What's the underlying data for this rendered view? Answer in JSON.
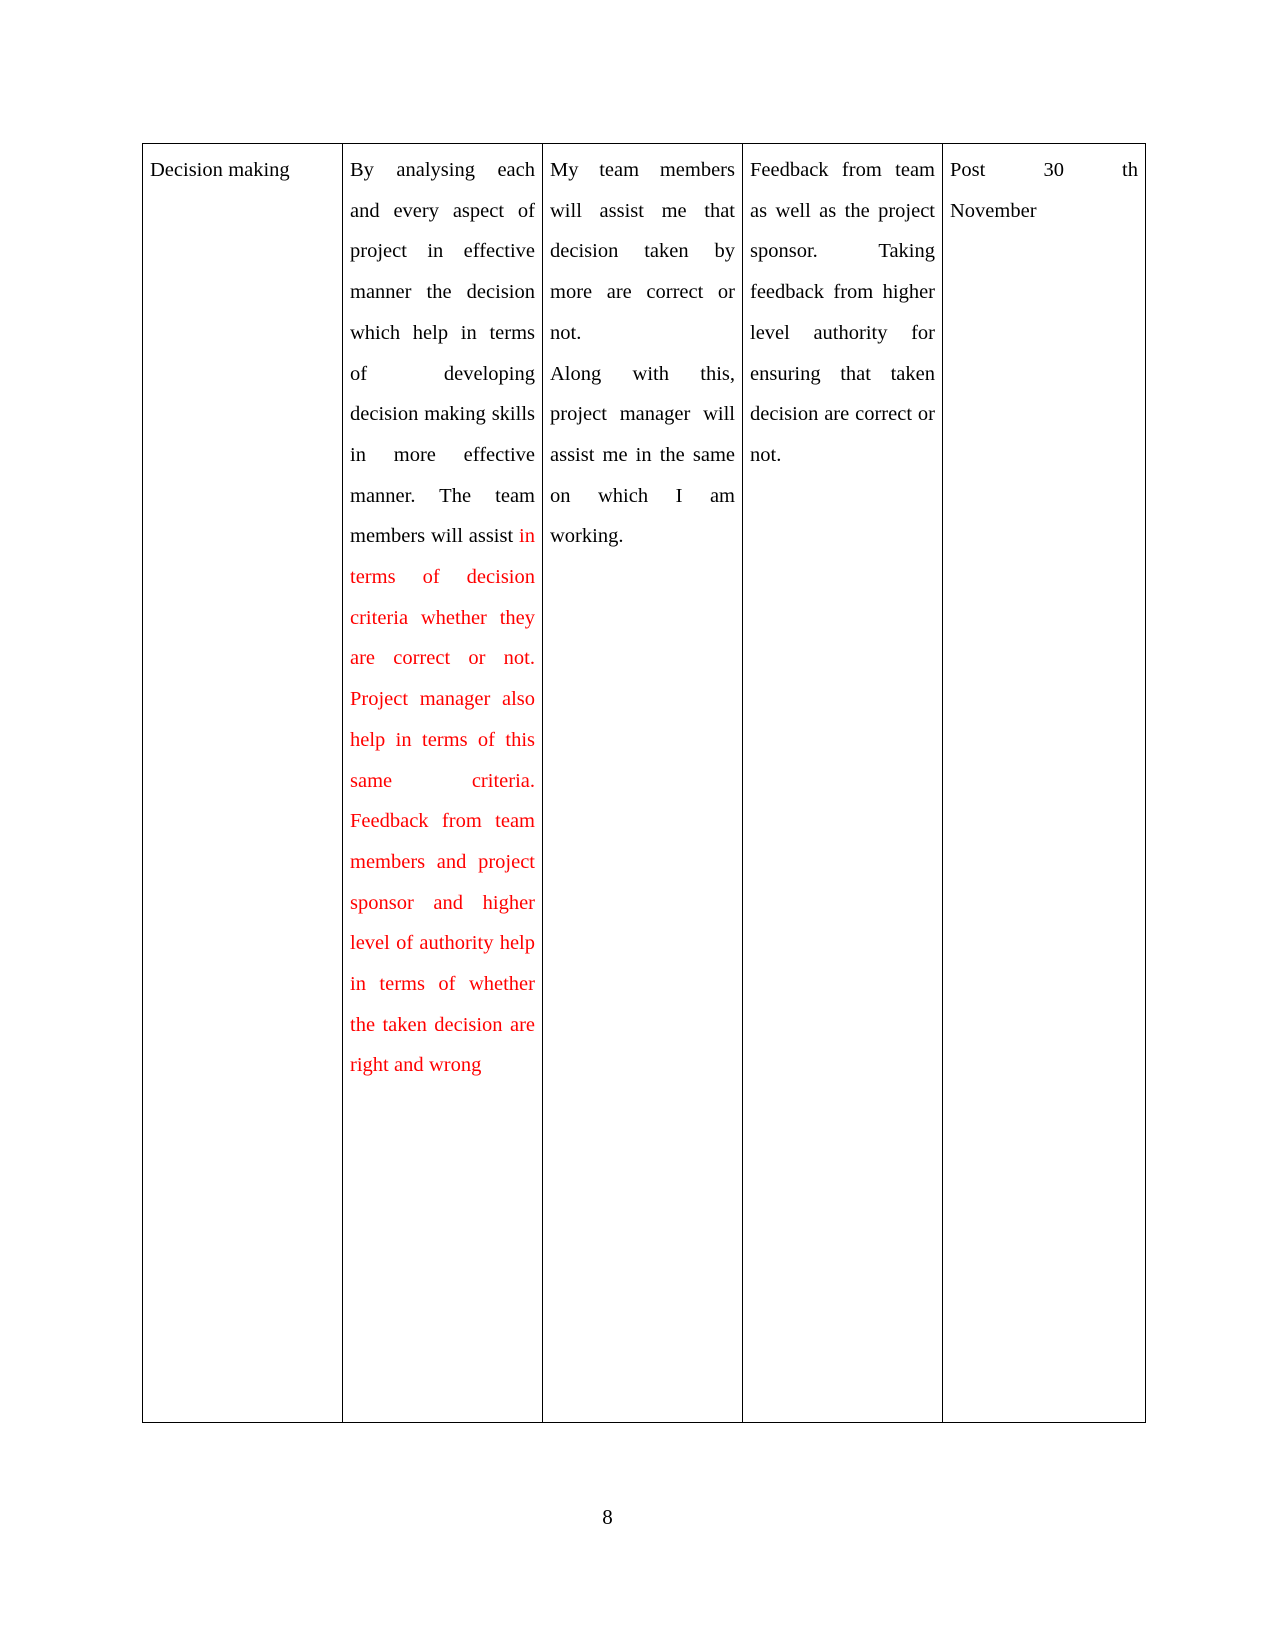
{
  "document": {
    "page_number": "8",
    "table": {
      "row": {
        "cells": [
          {
            "name": "activity-name",
            "text": "Decision making",
            "color": "#000000"
          },
          {
            "name": "description",
            "black_text": "By analysing each and every aspect of project in effective manner the decision which help in terms of developing decision making skills in more effective manner. The team members will assist ",
            "red_text": "in terms of decision criteria whether they are correct or not. Project manager also help in terms of this same criteria. Feedback from team members and project sponsor and higher level of authority help in terms of whether the taken decision are right and wrong",
            "red_color": "#ff0000"
          },
          {
            "name": "support-required",
            "paragraph_1": "My team members will assist me that decision taken by more are correct or not.",
            "paragraph_2": "Along with this, project manager will assist me in the same on which I am working.",
            "color": "#000000"
          },
          {
            "name": "evidence-measure",
            "text": "Feedback from team as well as the project sponsor. Taking feedback from higher level authority for ensuring that taken decision are correct or not.",
            "color": "#000000"
          },
          {
            "name": "target-date",
            "line_1": "Post 30 th",
            "line_2": "November",
            "color": "#000000"
          }
        ]
      }
    }
  }
}
